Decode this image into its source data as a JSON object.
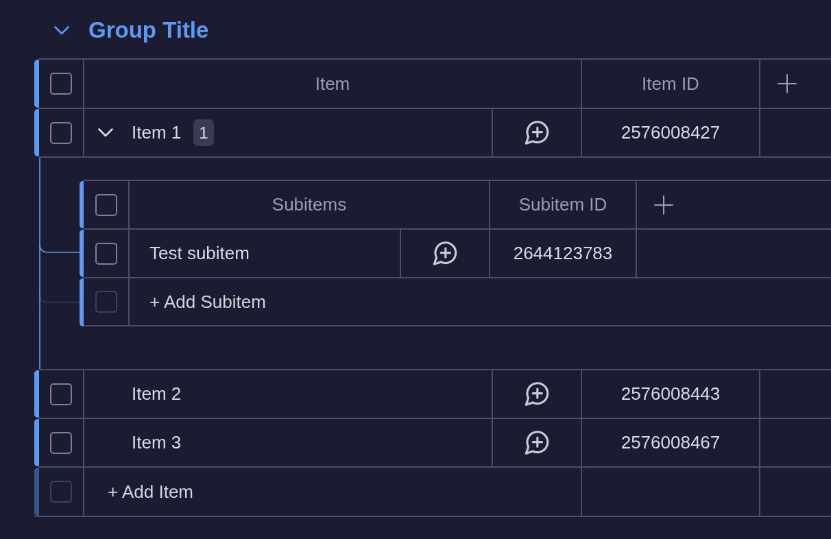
{
  "group": {
    "title": "Group Title",
    "expanded": true
  },
  "table": {
    "header_checked": false,
    "columns": [
      {
        "label": "Item"
      },
      {
        "label": "Item ID"
      }
    ],
    "rows": [
      {
        "name": "Item 1",
        "checked": false,
        "item_id": "2576008427",
        "subitem_count": "1",
        "expanded": true,
        "subitems": {
          "header_checked": false,
          "columns": [
            {
              "label": "Subitems"
            },
            {
              "label": "Subitem ID"
            }
          ],
          "rows": [
            {
              "name": "Test subitem",
              "checked": false,
              "subitem_id": "2644123783"
            }
          ],
          "add_row": {
            "label": "+ Add Subitem",
            "checked": false,
            "disabled": true
          }
        }
      },
      {
        "name": "Item 2",
        "checked": false,
        "item_id": "2576008443"
      },
      {
        "name": "Item 3",
        "checked": false,
        "item_id": "2576008467"
      }
    ],
    "add_row": {
      "label": "+ Add Item",
      "checked": false,
      "disabled": true
    }
  }
}
